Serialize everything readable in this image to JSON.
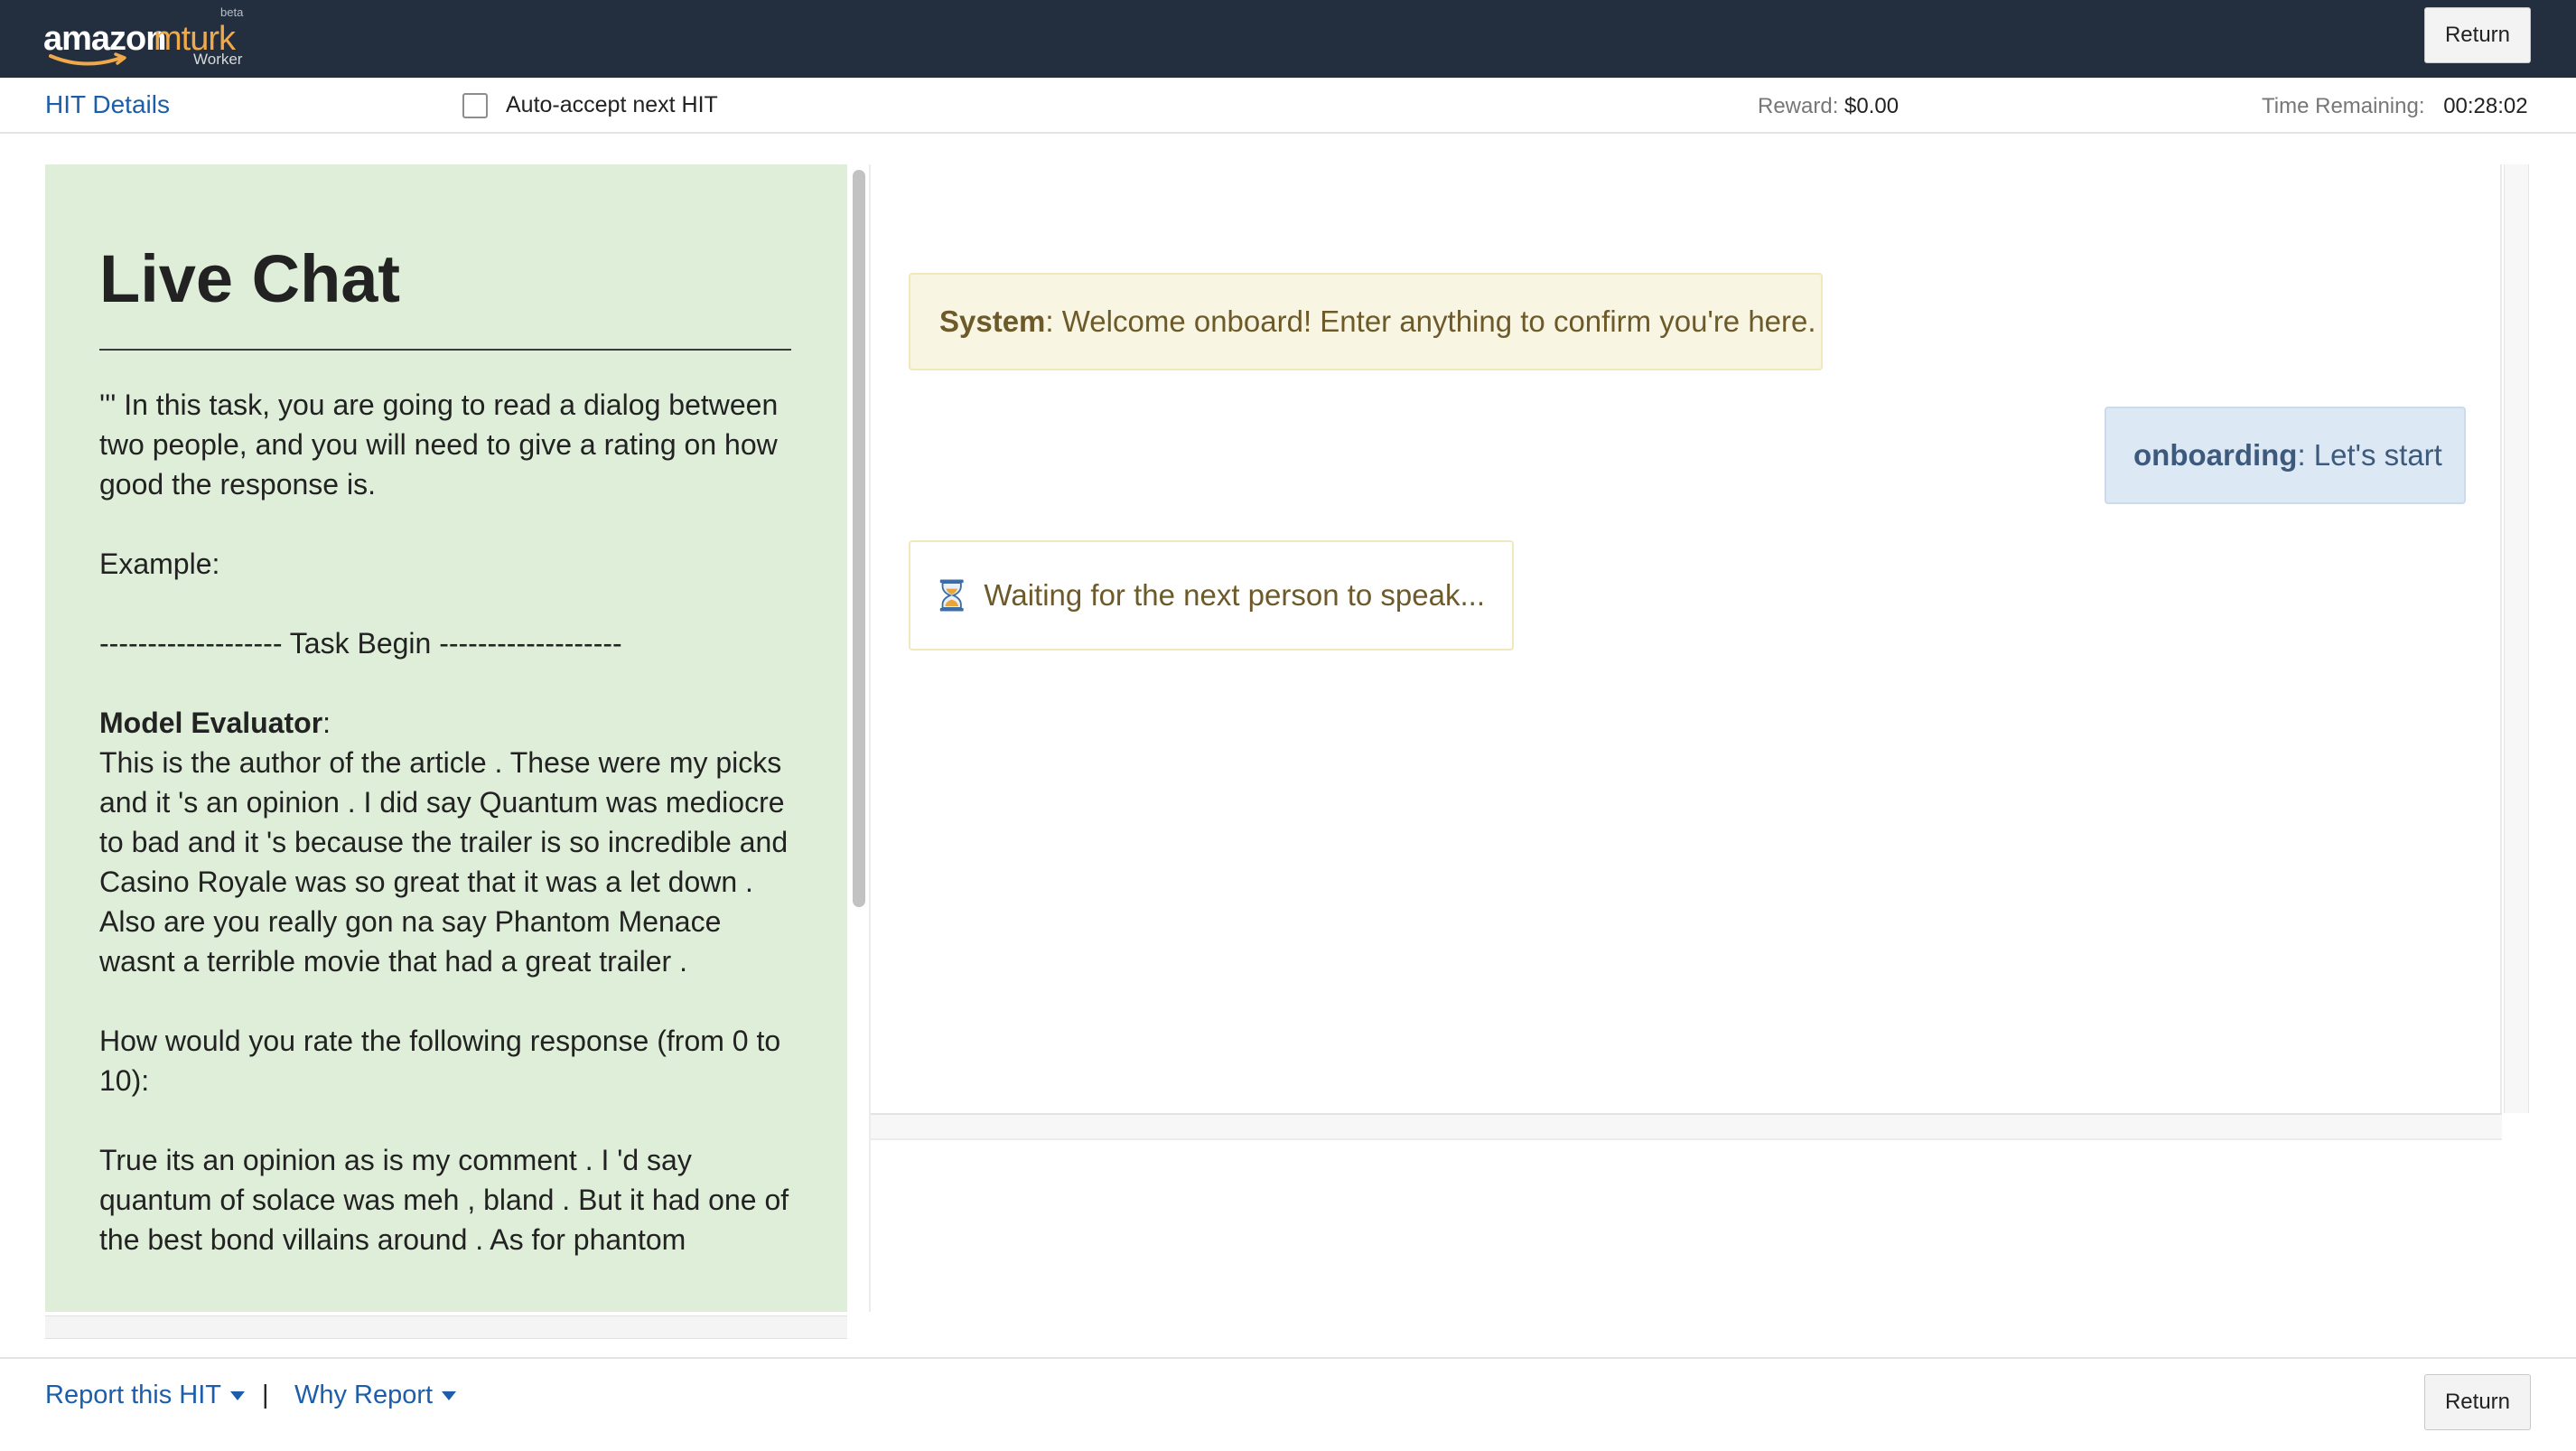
{
  "brand": {
    "amazon": "amazon",
    "mturk": "mturk",
    "beta": "beta",
    "worker": "Worker"
  },
  "topbar": {
    "return_label": "Return"
  },
  "subbar": {
    "hit_details": "HIT Details",
    "auto_accept_label": "Auto-accept next HIT",
    "auto_accept_checked": false,
    "reward_label": "Reward:",
    "reward_value": "$0.00",
    "time_label": "Time Remaining:",
    "time_value": "00:28:02"
  },
  "instructions": {
    "title": "Live Chat",
    "intro": "''' In this task, you are going to read a dialog between two people, and you will need to give a rating on how good the response is.",
    "example_label": "Example:",
    "task_begin": "------------------- Task Begin -------------------",
    "speaker": "Model Evaluator",
    "speaker_colon": ":",
    "context": "This is the author of the article . These were my picks and it 's an opinion . I did say Quantum was mediocre to bad and it 's because the trailer is so incredible and Casino Royale was so great that it was a let down . Also are you really gon na say Phantom Menace wasnt a terrible movie that had a great trailer .",
    "question": "How would you rate the following response (from 0 to 10):",
    "response": "True its an opinion as is my comment . I 'd say quantum of solace was meh , bland . But it had one of the best bond villains around . As for phantom"
  },
  "chat": {
    "system_sender": "System",
    "system_text": ": Welcome onboard! Enter anything to confirm you're here.",
    "self_sender": "onboarding",
    "self_text": ": Let's start",
    "waiting_text": "Waiting for the next person to speak..."
  },
  "footer": {
    "report_hit": "Report this HIT",
    "separator": "|",
    "why_report": "Why Report",
    "return_label": "Return"
  },
  "colors": {
    "navbar": "#232f3e",
    "link": "#1c5ea9",
    "instructions_bg": "#dfeed8",
    "system_bg": "#f8f6e2",
    "self_bg": "#dce8f4",
    "mturk_orange": "#f0a94a"
  }
}
